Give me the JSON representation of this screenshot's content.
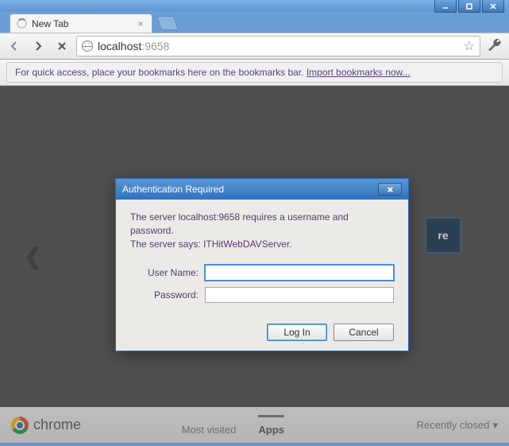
{
  "window": {
    "tab_title": "New Tab",
    "url_host": "localhost",
    "url_port": ":9658"
  },
  "bookmarks_bar": {
    "hint": "For quick access, place your bookmarks here on the bookmarks bar.  ",
    "import_link": "Import bookmarks now..."
  },
  "ntp": {
    "tile_partial": "re",
    "logo_text": "chrome",
    "footer_mostvisited": "Most visited",
    "footer_apps": "Apps",
    "footer_recent": "Recently closed"
  },
  "dialog": {
    "title": "Authentication Required",
    "message_line1": "The server localhost:9658 requires a username and password.",
    "message_line2": "The server says: ITHitWebDAVServer.",
    "username_label": "User Name:",
    "password_label": "Password:",
    "username_value": "",
    "password_value": "",
    "login_btn": "Log In",
    "cancel_btn": "Cancel"
  }
}
